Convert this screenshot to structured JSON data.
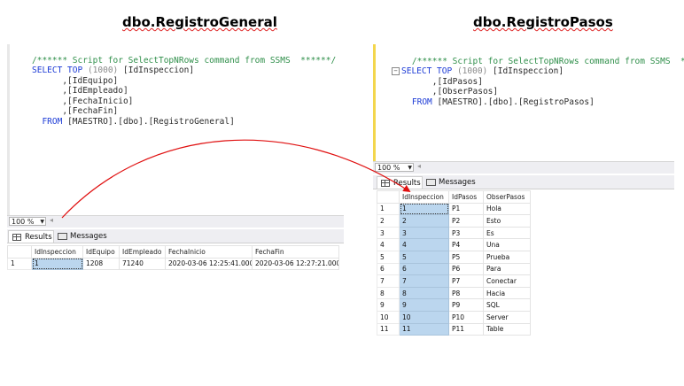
{
  "left_title": "dbo.RegistroGeneral",
  "right_title": "dbo.RegistroPasos",
  "left_query": {
    "comment": "/****** Script for SelectTopNRows command from SSMS  ******/",
    "select_kw": "SELECT TOP",
    "top_n": "(1000)",
    "col1": "[IdInspeccion]",
    "cols": [
      ",[IdEquipo]",
      ",[IdEmpleado]",
      ",[FechaInicio]",
      ",[FechaFin]"
    ],
    "from_kw": "FROM",
    "source": "[MAESTRO].[dbo].[RegistroGeneral]"
  },
  "right_query": {
    "comment": "/****** Script for SelectTopNRows command from SSMS  ******/",
    "select_kw": "SELECT TOP",
    "top_n": "(1000)",
    "col1": "[IdInspeccion]",
    "cols": [
      ",[IdPasos]",
      ",[ObserPasos]"
    ],
    "from_kw": "FROM",
    "source": "[MAESTRO].[dbo].[RegistroPasos]"
  },
  "zoom": "100 %",
  "tabs": {
    "results": "Results",
    "messages": "Messages"
  },
  "left_grid": {
    "headers": [
      "IdInspeccion",
      "IdEquipo",
      "IdEmpleado",
      "FechaInicio",
      "FechaFin"
    ],
    "rows": [
      [
        "1",
        "1",
        "1208",
        "71240",
        "2020-03-06 12:25:41.000",
        "2020-03-06 12:27:21.000"
      ]
    ]
  },
  "right_grid": {
    "headers": [
      "IdInspeccion",
      "IdPasos",
      "ObserPasos"
    ],
    "rows": [
      [
        "1",
        "1",
        "P1",
        "Hola"
      ],
      [
        "2",
        "2",
        "P2",
        "Esto"
      ],
      [
        "3",
        "3",
        "P3",
        "Es"
      ],
      [
        "4",
        "4",
        "P4",
        "Una"
      ],
      [
        "5",
        "5",
        "P5",
        "Prueba"
      ],
      [
        "6",
        "6",
        "P6",
        "Para"
      ],
      [
        "7",
        "7",
        "P7",
        "Conectar"
      ],
      [
        "8",
        "8",
        "P8",
        "Hacia"
      ],
      [
        "9",
        "9",
        "P9",
        "SQL"
      ],
      [
        "10",
        "10",
        "P10",
        "Server"
      ],
      [
        "11",
        "11",
        "P11",
        "Table"
      ]
    ]
  },
  "colors": {
    "arrow": "#e01010",
    "selected_cell": "#bbd6ee",
    "keyword": "#1c3bd6",
    "comment": "#2f8f4a"
  }
}
